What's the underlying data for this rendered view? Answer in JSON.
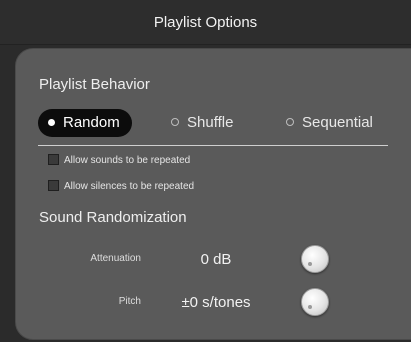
{
  "window": {
    "title": "Playlist Options"
  },
  "playlist_behavior": {
    "heading": "Playlist Behavior",
    "modes": [
      {
        "label": "Random",
        "selected": true
      },
      {
        "label": "Shuffle",
        "selected": false
      },
      {
        "label": "Sequential",
        "selected": false
      }
    ],
    "options": [
      {
        "label": "Allow sounds to be repeated",
        "checked": false
      },
      {
        "label": "Allow silences to be repeated",
        "checked": false
      }
    ]
  },
  "sound_randomization": {
    "heading": "Sound Randomization",
    "attenuation": {
      "label": "Attenuation",
      "value": "0 dB"
    },
    "pitch": {
      "label": "Pitch",
      "value": "±0 s/tones"
    }
  },
  "colors": {
    "background": "#2b2b2b",
    "panel": "#5a5a5a",
    "selected_segment": "#0c0c0c",
    "text": "#eeeeee"
  }
}
